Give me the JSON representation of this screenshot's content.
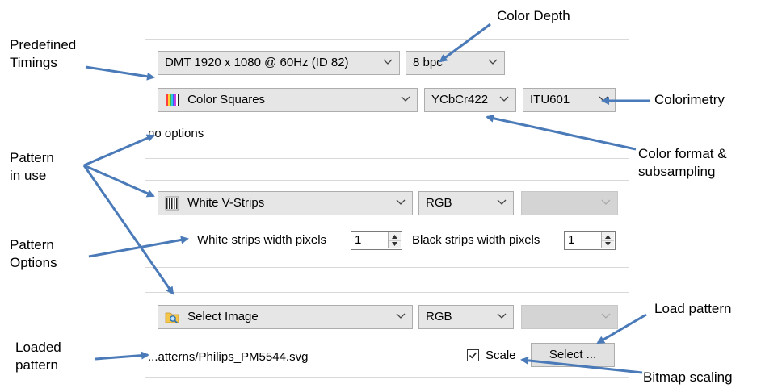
{
  "colors": {
    "arrow": "#4a7ab8",
    "panel_border": "#d9d9d9",
    "combo_bg": "#e6e6e6"
  },
  "panel1": {
    "timing_select": "DMT 1920 x 1080 @ 60Hz (ID 82)",
    "color_depth_select": "8 bpc",
    "pattern_select": {
      "icon": "color-squares-icon",
      "label": "Color Squares"
    },
    "color_format_select": "YCbCr422",
    "colorimetry_select": "ITU601",
    "options_text": "no options"
  },
  "panel2": {
    "pattern_select": {
      "icon": "vertical-strips-icon",
      "label": "White V-Strips"
    },
    "color_format_select": "RGB",
    "colorimetry_select": "",
    "white_strips_label": "White strips width pixels",
    "white_strips_value": "1",
    "black_strips_label": "Black strips width pixels",
    "black_strips_value": "1"
  },
  "panel3": {
    "pattern_select": {
      "icon": "folder-search-icon",
      "label": "Select Image"
    },
    "color_format_select": "RGB",
    "colorimetry_select": "",
    "file_path": "...atterns/Philips_PM5544.svg",
    "scale_label": "Scale",
    "scale_checked": true,
    "select_button": "Select ..."
  },
  "annotations": {
    "predefined_timings": [
      "Predefined",
      "Timings"
    ],
    "color_depth": "Color Depth",
    "colorimetry": "Colorimetry",
    "color_format": [
      "Color format &",
      "subsampling"
    ],
    "pattern_in_use": [
      "Pattern",
      "in use"
    ],
    "pattern_options": [
      "Pattern",
      "Options"
    ],
    "loaded_pattern": [
      "Loaded",
      "pattern"
    ],
    "load_pattern": "Load pattern",
    "bitmap_scaling": "Bitmap scaling"
  }
}
